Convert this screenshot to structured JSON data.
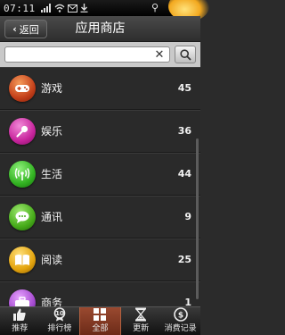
{
  "status_bar": {
    "time": "07:11"
  },
  "header": {
    "back_label": "返回",
    "title": "应用商店"
  },
  "search": {
    "value": "",
    "placeholder": ""
  },
  "categories": [
    {
      "label": "游戏",
      "count": "45",
      "icon": "gamepad-icon",
      "color": "#d2541f"
    },
    {
      "label": "娱乐",
      "count": "36",
      "icon": "microphone-icon",
      "color": "#c8259d"
    },
    {
      "label": "生活",
      "count": "44",
      "icon": "signal-icon",
      "color": "#33b322"
    },
    {
      "label": "通讯",
      "count": "9",
      "icon": "chat-icon",
      "color": "#47ac1a"
    },
    {
      "label": "阅读",
      "count": "25",
      "icon": "book-icon",
      "color": "#e3a40e"
    },
    {
      "label": "商务",
      "count": "1",
      "icon": "briefcase-icon",
      "color": "#a54ad0"
    }
  ],
  "tabs": [
    {
      "label": "推荐",
      "icon": "thumbs-up-icon"
    },
    {
      "label": "排行榜",
      "icon": "ranking-icon"
    },
    {
      "label": "全部",
      "icon": "grid-icon",
      "active": true
    },
    {
      "label": "更新",
      "icon": "hourglass-icon"
    },
    {
      "label": "消费记录",
      "icon": "dollar-icon"
    }
  ]
}
